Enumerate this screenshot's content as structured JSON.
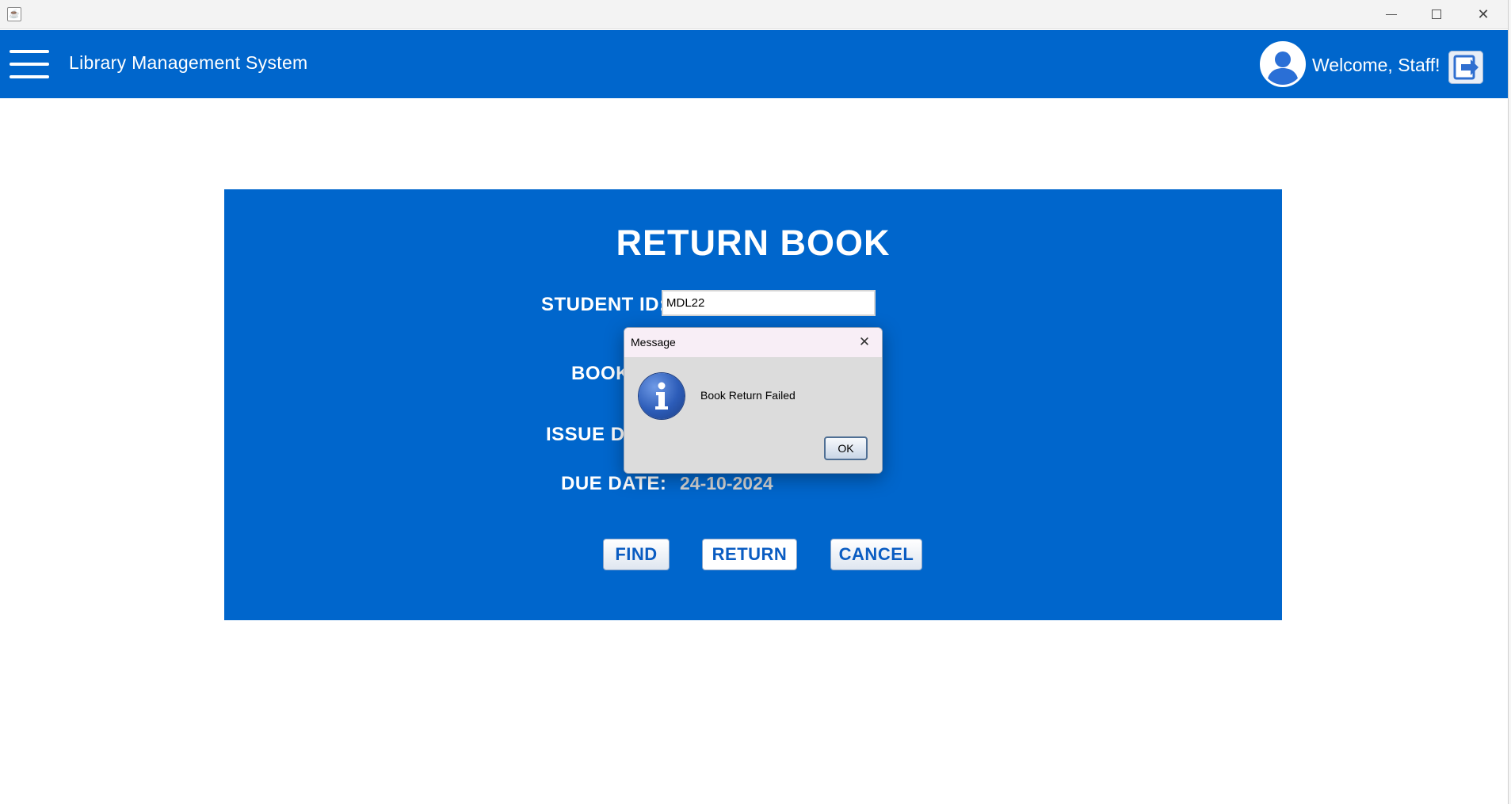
{
  "window": {
    "app_icon": "java-app-icon",
    "minimize_icon": "minimize-icon",
    "maximize_icon": "maximize-icon",
    "close_glyph": "✕"
  },
  "header": {
    "title": "Library Management System",
    "welcome": "Welcome, Staff!",
    "menu_icon": "hamburger-menu-icon",
    "avatar_icon": "user-avatar-icon",
    "logout_icon": "logout-icon"
  },
  "form": {
    "title": "RETURN BOOK",
    "student_id_label": "STUDENT ID:",
    "student_id_value": "MDL22",
    "book_label": "BOOK",
    "issue_label": "ISSUE DA",
    "due_label": "DUE DATE:",
    "due_value": "24-10-2024",
    "find_button": "FIND",
    "return_button": "RETURN",
    "cancel_button": "CANCEL"
  },
  "dialog": {
    "title": "Message",
    "message": "Book Return Failed",
    "ok_button": "OK",
    "close_glyph": "✕",
    "icon": "info-icon"
  },
  "colors": {
    "brand_blue": "#0066cc",
    "button_text": "#0a5cc2",
    "due_value_text": "#d3d3d3"
  }
}
